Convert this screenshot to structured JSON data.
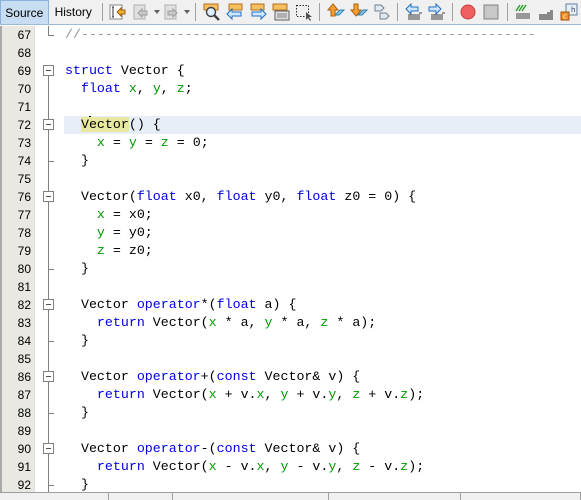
{
  "toolbar": {
    "tabs": [
      {
        "label": "Source",
        "active": true
      },
      {
        "label": "History",
        "active": false
      }
    ],
    "buttons": [
      {
        "icon": "last-edit-icon",
        "tooltip": "Last Edit"
      },
      {
        "icon": "back-icon",
        "tooltip": "Back",
        "disabled": true
      },
      {
        "icon": "forward-icon",
        "tooltip": "Forward",
        "disabled": true
      },
      {
        "icon": "find-icon",
        "tooltip": "Find"
      },
      {
        "icon": "find-previous-icon",
        "tooltip": "Find Previous"
      },
      {
        "icon": "find-next-icon",
        "tooltip": "Find Next"
      },
      {
        "icon": "toggle-highlight-icon",
        "tooltip": "Toggle Highlight Search"
      },
      {
        "icon": "rect-selection-icon",
        "tooltip": "Rectangular Selection"
      },
      {
        "icon": "previous-bookmark-icon",
        "tooltip": "Previous Bookmark"
      },
      {
        "icon": "next-bookmark-icon",
        "tooltip": "Next Bookmark"
      },
      {
        "icon": "toggle-bookmark-icon",
        "tooltip": "Toggle Bookmark"
      },
      {
        "icon": "shift-left-icon",
        "tooltip": "Shift Line Left"
      },
      {
        "icon": "shift-right-icon",
        "tooltip": "Shift Line Right"
      },
      {
        "icon": "start-macro-icon",
        "tooltip": "Start Macro Recording"
      },
      {
        "icon": "stop-macro-icon",
        "tooltip": "Stop Macro Recording"
      },
      {
        "icon": "comment-icon",
        "tooltip": "Comment"
      },
      {
        "icon": "uncomment-icon",
        "tooltip": "Uncomment"
      },
      {
        "icon": "switch-header-icon",
        "tooltip": "Switch Header/Source"
      }
    ]
  },
  "editor": {
    "current_line": 72,
    "lines": [
      {
        "n": "67",
        "tokens": [
          {
            "t": "//---------------------------------------------------------",
            "c": "cmt"
          }
        ]
      },
      {
        "n": "68",
        "tokens": []
      },
      {
        "n": "69",
        "tokens": [
          {
            "t": "struct",
            "c": "kw"
          },
          {
            "t": " Vector {"
          }
        ]
      },
      {
        "n": "70",
        "tokens": [
          {
            "t": "  "
          },
          {
            "t": "float",
            "c": "kw"
          },
          {
            "t": " "
          },
          {
            "t": "x",
            "c": "fld"
          },
          {
            "t": ", "
          },
          {
            "t": "y",
            "c": "fld"
          },
          {
            "t": ", "
          },
          {
            "t": "z",
            "c": "fld"
          },
          {
            "t": ";"
          }
        ]
      },
      {
        "n": "71",
        "tokens": []
      },
      {
        "n": "72",
        "tokens": [
          {
            "t": "  "
          },
          {
            "t": "V",
            "c": "hl"
          },
          {
            "t": "CARET"
          },
          {
            "t": "ector",
            "c": "hl"
          },
          {
            "t": "() {"
          }
        ]
      },
      {
        "n": "73",
        "tokens": [
          {
            "t": "    "
          },
          {
            "t": "x",
            "c": "fld"
          },
          {
            "t": " = "
          },
          {
            "t": "y",
            "c": "fld"
          },
          {
            "t": " = "
          },
          {
            "t": "z",
            "c": "fld"
          },
          {
            "t": " = 0;"
          }
        ]
      },
      {
        "n": "74",
        "tokens": [
          {
            "t": "  }"
          }
        ]
      },
      {
        "n": "75",
        "tokens": []
      },
      {
        "n": "76",
        "tokens": [
          {
            "t": "  Vector("
          },
          {
            "t": "float",
            "c": "kw"
          },
          {
            "t": " x0, "
          },
          {
            "t": "float",
            "c": "kw"
          },
          {
            "t": " y0, "
          },
          {
            "t": "float",
            "c": "kw"
          },
          {
            "t": " z0 = 0) {"
          }
        ]
      },
      {
        "n": "77",
        "tokens": [
          {
            "t": "    "
          },
          {
            "t": "x",
            "c": "fld"
          },
          {
            "t": " = x0;"
          }
        ]
      },
      {
        "n": "78",
        "tokens": [
          {
            "t": "    "
          },
          {
            "t": "y",
            "c": "fld"
          },
          {
            "t": " = y0;"
          }
        ]
      },
      {
        "n": "79",
        "tokens": [
          {
            "t": "    "
          },
          {
            "t": "z",
            "c": "fld"
          },
          {
            "t": " = z0;"
          }
        ]
      },
      {
        "n": "80",
        "tokens": [
          {
            "t": "  }"
          }
        ]
      },
      {
        "n": "81",
        "tokens": []
      },
      {
        "n": "82",
        "tokens": [
          {
            "t": "  Vector "
          },
          {
            "t": "operator",
            "c": "kw"
          },
          {
            "t": "*("
          },
          {
            "t": "float",
            "c": "kw"
          },
          {
            "t": " a) {"
          }
        ]
      },
      {
        "n": "83",
        "tokens": [
          {
            "t": "    "
          },
          {
            "t": "return",
            "c": "kw"
          },
          {
            "t": " Vector("
          },
          {
            "t": "x",
            "c": "fld"
          },
          {
            "t": " * a, "
          },
          {
            "t": "y",
            "c": "fld"
          },
          {
            "t": " * a, "
          },
          {
            "t": "z",
            "c": "fld"
          },
          {
            "t": " * a);"
          }
        ]
      },
      {
        "n": "84",
        "tokens": [
          {
            "t": "  }"
          }
        ]
      },
      {
        "n": "85",
        "tokens": []
      },
      {
        "n": "86",
        "tokens": [
          {
            "t": "  Vector "
          },
          {
            "t": "operator",
            "c": "kw"
          },
          {
            "t": "+("
          },
          {
            "t": "const",
            "c": "kw"
          },
          {
            "t": " Vector& v) {"
          }
        ]
      },
      {
        "n": "87",
        "tokens": [
          {
            "t": "    "
          },
          {
            "t": "return",
            "c": "kw"
          },
          {
            "t": " Vector("
          },
          {
            "t": "x",
            "c": "fld"
          },
          {
            "t": " + v."
          },
          {
            "t": "x",
            "c": "fld"
          },
          {
            "t": ", "
          },
          {
            "t": "y",
            "c": "fld"
          },
          {
            "t": " + v."
          },
          {
            "t": "y",
            "c": "fld"
          },
          {
            "t": ", "
          },
          {
            "t": "z",
            "c": "fld"
          },
          {
            "t": " + v."
          },
          {
            "t": "z",
            "c": "fld"
          },
          {
            "t": ");"
          }
        ]
      },
      {
        "n": "88",
        "tokens": [
          {
            "t": "  }"
          }
        ]
      },
      {
        "n": "89",
        "tokens": []
      },
      {
        "n": "90",
        "tokens": [
          {
            "t": "  Vector "
          },
          {
            "t": "operator",
            "c": "kw"
          },
          {
            "t": "-("
          },
          {
            "t": "const",
            "c": "kw"
          },
          {
            "t": " Vector& v) {"
          }
        ]
      },
      {
        "n": "91",
        "tokens": [
          {
            "t": "    "
          },
          {
            "t": "return",
            "c": "kw"
          },
          {
            "t": " Vector("
          },
          {
            "t": "x",
            "c": "fld"
          },
          {
            "t": " - v."
          },
          {
            "t": "x",
            "c": "fld"
          },
          {
            "t": ", "
          },
          {
            "t": "y",
            "c": "fld"
          },
          {
            "t": " - v."
          },
          {
            "t": "y",
            "c": "fld"
          },
          {
            "t": ", "
          },
          {
            "t": "z",
            "c": "fld"
          },
          {
            "t": " - v."
          },
          {
            "t": "z",
            "c": "fld"
          },
          {
            "t": ");"
          }
        ]
      },
      {
        "n": "92",
        "tokens": [
          {
            "t": "  }"
          }
        ]
      }
    ],
    "folds": [
      {
        "start": 69,
        "end": null
      },
      {
        "start": 72,
        "end": 74
      },
      {
        "start": 76,
        "end": 80
      },
      {
        "start": 82,
        "end": 84
      },
      {
        "start": 86,
        "end": 88
      },
      {
        "start": 90,
        "end": 92
      }
    ],
    "fold_ends_outer": [
      67
    ]
  },
  "colors": {
    "keyword": "#0000e6",
    "field": "#009900",
    "comment": "#969696",
    "current_line": "#e8eef8",
    "identifier_highlight": "#e8e8a0",
    "active_tab": "#c8ddf2"
  }
}
